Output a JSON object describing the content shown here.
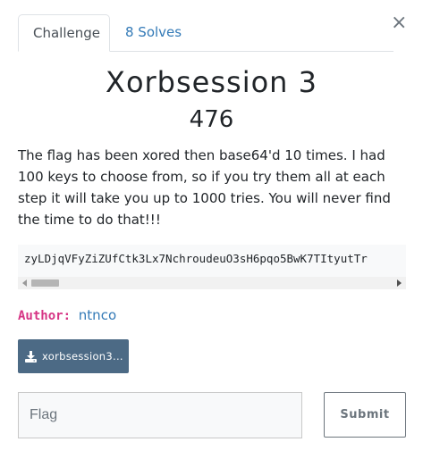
{
  "modal": {
    "close_glyph": "×"
  },
  "tabs": [
    {
      "label": "Challenge",
      "active": true
    },
    {
      "label": "8 Solves",
      "active": false
    }
  ],
  "challenge": {
    "name": "Xorbsession 3",
    "points": "476",
    "description": "The flag has been xored then base64'd 10 times. I had 100 keys to choose from, so if you try them all at each step it will take you up to 1000 tries. You will never find the time to do that!!!",
    "code": "zyLDjqVFyZiZUfCtk3Lx7NchroudeuO3sH6pqo5BwK7TItyutTr"
  },
  "author": {
    "label": "Author:",
    "name": "ntnco"
  },
  "file": {
    "label": "xorbsession3...",
    "icon": "download-icon"
  },
  "flag": {
    "placeholder": "Flag",
    "value": ""
  },
  "submit_label": "Submit",
  "colors": {
    "link": "#337ab7",
    "file_button": "#4c6a85",
    "author_label": "#d63384"
  }
}
